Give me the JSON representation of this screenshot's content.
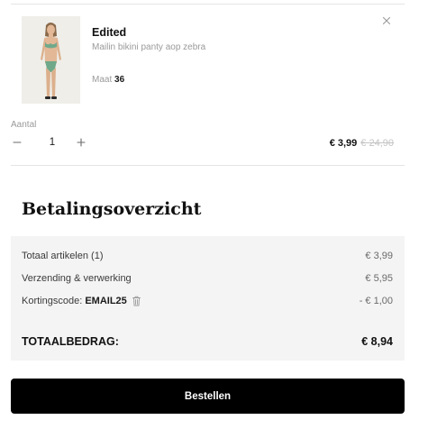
{
  "cart_item": {
    "brand": "Edited",
    "product_name": "Mailin bikini panty aop zebra",
    "size_label": "Maat",
    "size_value": "36",
    "quantity_label": "Aantal",
    "quantity_value": "1",
    "price_current": "€ 3,99",
    "price_original": "€ 24,90"
  },
  "summary": {
    "title": "Betalingsoverzicht",
    "rows": [
      {
        "label": "Totaal artikelen (1)",
        "value": "€ 3,99"
      },
      {
        "label": "Verzending & verwerking",
        "value": "€ 5,95"
      },
      {
        "label": "Kortingscode:",
        "code": "EMAIL25",
        "value": "- € 1,00"
      }
    ],
    "total_label": "TOTAALBEDRAG:",
    "total_value": "€ 8,94"
  },
  "checkout": {
    "button_label": "Bestellen"
  },
  "icons": {
    "remove": "close-icon",
    "decrease": "minus-icon",
    "increase": "plus-icon",
    "remove_code": "trash-icon"
  },
  "colors": {
    "button_bg": "#000000",
    "summary_bg": "#f4f4f4",
    "muted_text": "#9a9a9a",
    "strike_price": "#c4c4c4"
  }
}
